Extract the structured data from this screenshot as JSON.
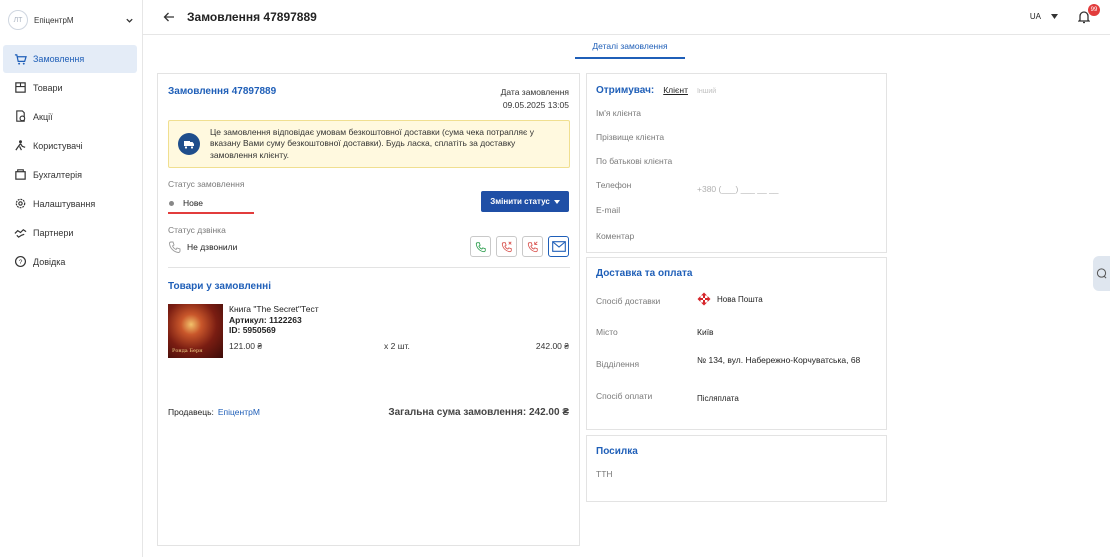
{
  "sidebar": {
    "brand": "ЕпіцентрМ",
    "logo_text": "ЛТ",
    "items": [
      {
        "label": "Замовлення",
        "icon": "cart-icon",
        "active": true
      },
      {
        "label": "Товари",
        "icon": "box-icon"
      },
      {
        "label": "Акції",
        "icon": "promo-icon"
      },
      {
        "label": "Користувачі",
        "icon": "users-icon"
      },
      {
        "label": "Бухгалтерія",
        "icon": "accounting-icon"
      },
      {
        "label": "Налаштування",
        "icon": "gear-icon"
      },
      {
        "label": "Партнери",
        "icon": "handshake-icon"
      },
      {
        "label": "Довідка",
        "icon": "help-icon"
      }
    ]
  },
  "header": {
    "title": "Замовлення 47897889",
    "lang": "UA",
    "notifications": "99"
  },
  "tabs": {
    "details": "Деталі замовлення"
  },
  "order": {
    "title": "Замовлення 47897889",
    "date_label": "Дата замовлення",
    "date_value": "09.05.2025 13:05",
    "notice": "Це замовлення відповідає умовам безкоштовної доставки (сума чека потрапляє у вказану Вами суму безкоштовної доставки). Будь ласка, сплатіть за доставку замовлення клієнту.",
    "status_label": "Статус замовлення",
    "status_value": "Нове",
    "change_status": "Змінити статус",
    "call_label": "Статус дзвінка",
    "call_value": "Не дзвонили",
    "goods_title": "Товари у замовленні",
    "item": {
      "name": "Книга \"The Secret\"Тест",
      "sku": "Артикул: 1122263",
      "id": "ID: 5950569",
      "price": "121.00 ₴",
      "qty": "x 2 шт.",
      "sum": "242.00 ₴",
      "cover_text": "Ронда Берн"
    },
    "seller_label": "Продавець:",
    "seller_name": "ЕпіцентрМ",
    "total": "Загальна сума замовлення: 242.00 ₴"
  },
  "recipient": {
    "title": "Отримувач:",
    "client_tab": "Клієнт",
    "other_tab": "Інший",
    "first_name": "Ім'я клієнта",
    "last_name": "Прізвище клієнта",
    "patronymic": "По батькові клієнта",
    "phone_label": "Телефон",
    "phone_value": "+380 (___) ___ __ __",
    "email_label": "E-mail",
    "comment_label": "Коментар"
  },
  "delivery": {
    "title": "Доставка та оплата",
    "method_label": "Спосіб доставки",
    "method_value": "Нова Пошта",
    "city_label": "Місто",
    "city_value": "Київ",
    "branch_label": "Відділення",
    "branch_value": "№ 134, вул. Набережно-Корчуватська, 68",
    "payment_label": "Спосіб оплати",
    "payment_value": "Післяплата"
  },
  "parcel": {
    "title": "Посилка",
    "ttn_label": "ТТН"
  },
  "colors": {
    "accent": "#1f5fb8",
    "button": "#1f4fa6",
    "error": "#e23c3c",
    "notice_bg": "#fff9df"
  }
}
